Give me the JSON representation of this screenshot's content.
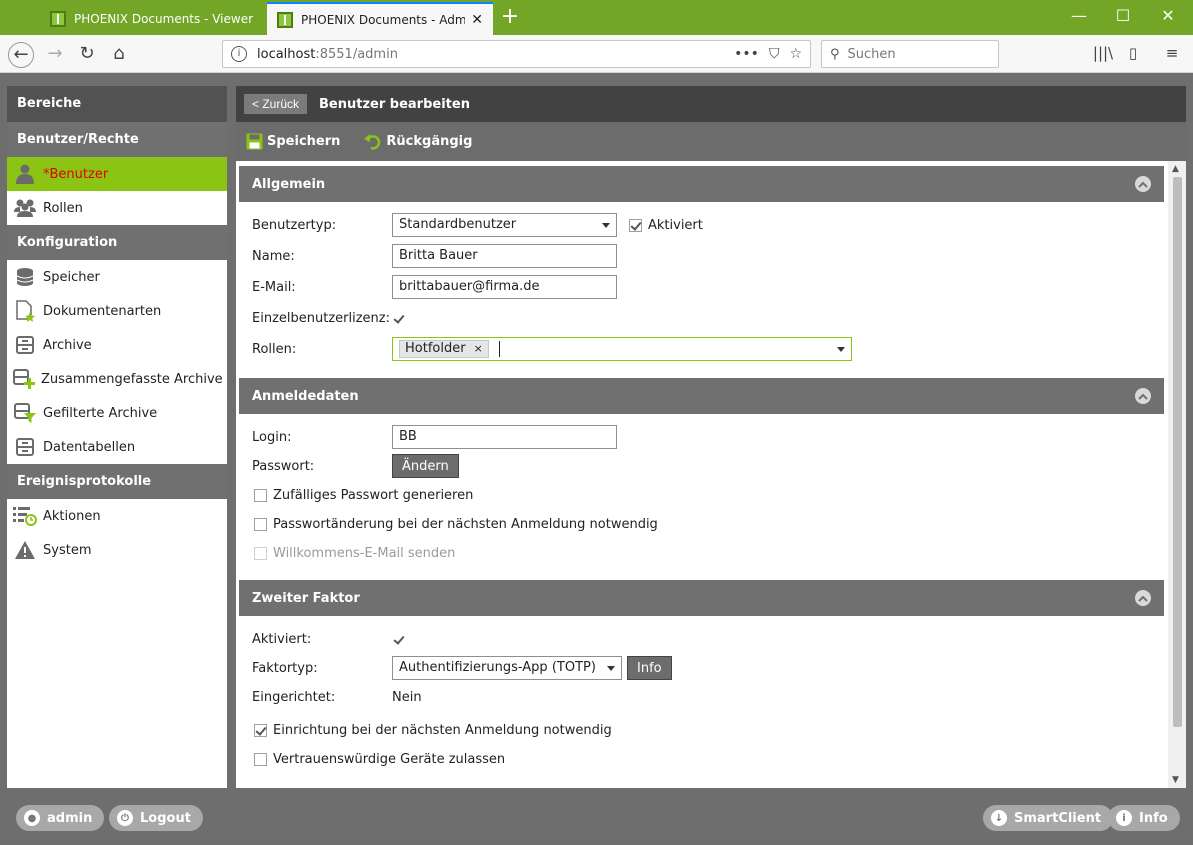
{
  "browser": {
    "tabs": [
      {
        "title": "PHOENIX Documents - Viewer"
      },
      {
        "title": "PHOENIX Documents - Admin"
      }
    ],
    "url_host": "localhost",
    "url_path": ":8551/admin",
    "search_placeholder": "Suchen"
  },
  "sidebar": {
    "header": "Bereiche",
    "sections": [
      {
        "title": "Benutzer/Rechte",
        "items": [
          {
            "label": "*Benutzer",
            "icon": "user-icon",
            "active": true
          },
          {
            "label": "Rollen",
            "icon": "group-icon"
          }
        ]
      },
      {
        "title": "Konfiguration",
        "items": [
          {
            "label": "Speicher",
            "icon": "database-icon"
          },
          {
            "label": "Dokumentenarten",
            "icon": "document-star-icon"
          },
          {
            "label": "Archive",
            "icon": "archive-icon"
          },
          {
            "label": "Zusammengefasste Archive",
            "icon": "archive-plus-icon"
          },
          {
            "label": "Gefilterte Archive",
            "icon": "archive-filter-icon"
          },
          {
            "label": "Datentabellen",
            "icon": "table-icon"
          }
        ]
      },
      {
        "title": "Ereignisprotokolle",
        "items": [
          {
            "label": "Aktionen",
            "icon": "list-clock-icon"
          },
          {
            "label": "System",
            "icon": "warning-icon"
          }
        ]
      }
    ]
  },
  "main": {
    "back_label": "< Zurück",
    "title": "Benutzer bearbeiten",
    "toolbar": {
      "save": "Speichern",
      "undo": "Rückgängig"
    }
  },
  "allgemein": {
    "title": "Allgemein",
    "usertype_label": "Benutzertyp:",
    "usertype_value": "Standardbenutzer",
    "activated_label": "Aktiviert",
    "name_label": "Name:",
    "name_value": "Britta Bauer",
    "email_label": "E-Mail:",
    "email_value": "brittabauer@firma.de",
    "license_label": "Einzelbenutzerlizenz:",
    "roles_label": "Rollen:",
    "roles_tag": "Hotfolder",
    "tag_remove": "×"
  },
  "anmeldedaten": {
    "title": "Anmeldedaten",
    "login_label": "Login:",
    "login_value": "BB",
    "password_label": "Passwort:",
    "change_button": "Ändern",
    "random_pw": "Zufälliges Passwort generieren",
    "pw_change_next": "Passwortänderung bei der nächsten Anmeldung notwendig",
    "welcome_mail": "Willkommens-E-Mail senden"
  },
  "zweiter_faktor": {
    "title": "Zweiter Faktor",
    "activated_label": "Aktiviert:",
    "type_label": "Faktortyp:",
    "type_value": "Authentifizierungs-App (TOTP)",
    "info_button": "Info",
    "setup_label": "Eingerichtet:",
    "setup_value": "Nein",
    "setup_next": "Einrichtung bei der nächsten Anmeldung notwendig",
    "trusted_devices": "Vertrauenswürdige Geräte zulassen"
  },
  "footer": {
    "user": "admin",
    "logout": "Logout",
    "smartclient": "SmartClient",
    "info": "Info"
  },
  "colors": {
    "accent": "#8cc414",
    "browser_green": "#73a626",
    "active_text": "#e20000"
  }
}
